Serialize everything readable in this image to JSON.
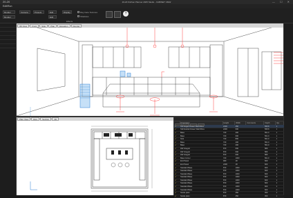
{
  "window": {
    "title": "20-20 Kitchen Planner 2025 Studio - CABINET VIEW",
    "app_badge": "20-20",
    "controls": "— ☐ ✕"
  },
  "menubar": {
    "item": "Edit/Run"
  },
  "ribbon": {
    "group1": [
      "Render Studio",
      "Render"
    ],
    "group2": [
      "Camera"
    ],
    "group3": [
      "Presets"
    ],
    "group4": [
      "Edit"
    ],
    "check1": "Ray trace Textures",
    "check2": "Shadows",
    "label_effects": "Effects",
    "label_display": "Display",
    "help": "?"
  },
  "viewport": {
    "tabs": [
      "3D View",
      "Front",
      "Side",
      "Plan",
      "Elevation",
      "Render"
    ]
  },
  "planview": {
    "tabs": [
      "Plan View",
      "Elev",
      "Section",
      "3D"
    ]
  },
  "grid": {
    "headers": [
      "",
      "Description",
      "Height",
      "Width",
      "Comments",
      "Depth",
      "Qty"
    ],
    "rows": [
      [
        "✔",
        "Tall Single Drawer Wall Wbox",
        "2200",
        "450",
        "",
        "595.8",
        "1"
      ],
      [
        "✔",
        "Tall Double Drawer Wall Wbox",
        "2200",
        "600",
        "",
        "595.8",
        "1"
      ],
      [
        "✔",
        "Base",
        "720",
        "400",
        "",
        "561.0",
        "1"
      ],
      [
        "✔",
        "Base",
        "720",
        "600",
        "",
        "561.0",
        "1"
      ],
      [
        "✔",
        "Sink",
        "720",
        "800",
        "",
        "561.0",
        "1"
      ],
      [
        "✔",
        "Base",
        "720",
        "400",
        "",
        "561.0",
        "1"
      ],
      [
        "✔",
        "Base",
        "720",
        "400",
        "",
        "561.0",
        "1"
      ],
      [
        "✔",
        "DW Integral",
        "870",
        "600",
        "",
        "580",
        "1"
      ],
      [
        "✔",
        "DW Integral",
        "870",
        "600",
        "",
        "580",
        "1"
      ],
      [
        "✔",
        "DW Integral",
        "870",
        "600",
        "",
        "580",
        "1"
      ],
      [
        "✔",
        "Base Corner",
        "720",
        "1000",
        "",
        "561.0",
        "1"
      ],
      [
        "✔",
        "End Panel",
        "900",
        "18",
        "",
        "600",
        "1"
      ],
      [
        "✔",
        "End Panel",
        "2200",
        "18",
        "",
        "600",
        "1"
      ],
      [
        "✔",
        "Standard Base",
        "870",
        "1000",
        "",
        "600",
        "1"
      ],
      [
        "✔",
        "Standard Base",
        "870",
        "1000",
        "",
        "600",
        "1"
      ],
      [
        "✔",
        "Standard Base",
        "870",
        "1000",
        "",
        "600",
        "1"
      ],
      [
        "✔",
        "Standard Base",
        "870",
        "1000",
        "",
        "600",
        "1"
      ],
      [
        "✔",
        "Standard Base",
        "870",
        "1000",
        "",
        "600",
        "1"
      ],
      [
        "✔",
        "Standard Base",
        "870",
        "1000",
        "",
        "600",
        "1"
      ],
      [
        "✔",
        "Standard Base",
        "870",
        "1000",
        "",
        "600",
        "1"
      ],
      [
        "✔",
        "Standard Base",
        "870",
        "1000",
        "",
        "600",
        "1"
      ],
      [
        "✔",
        "Stools plain",
        "870",
        "450",
        "",
        "450",
        "1"
      ],
      [
        "✔",
        "Stools plain",
        "870",
        "450",
        "",
        "450",
        "1"
      ]
    ]
  }
}
